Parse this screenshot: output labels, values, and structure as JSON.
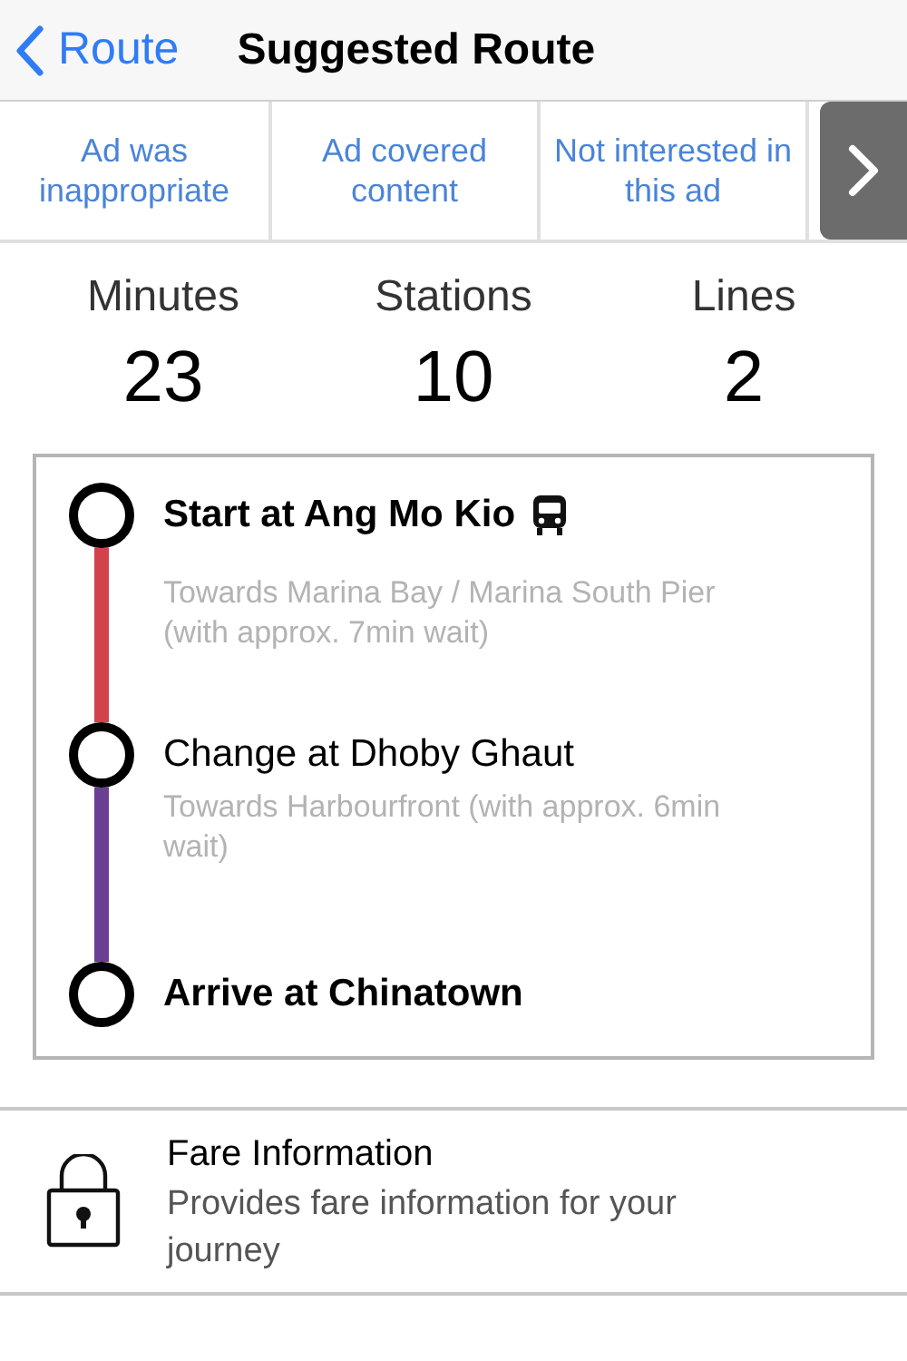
{
  "nav": {
    "back_label": "Route",
    "title": "Suggested Route"
  },
  "ad_feedback": {
    "options": [
      "Ad was inappropriate",
      "Ad covered content",
      "Not interested in this ad"
    ]
  },
  "stats": [
    {
      "label": "Minutes",
      "value": "23"
    },
    {
      "label": "Stations",
      "value": "10"
    },
    {
      "label": "Lines",
      "value": "2"
    }
  ],
  "route": {
    "stops": [
      {
        "name": "Start at Ang Mo Kio",
        "bold": true,
        "bus": true,
        "description": "Towards Marina Bay / Marina South Pier (with approx. 7min wait)",
        "color": "#d2424c"
      },
      {
        "name": "Change at Dhoby Ghaut",
        "bold": false,
        "bus": false,
        "description": "Towards Harbourfront (with approx. 6min wait)",
        "color": "#6a3e93"
      },
      {
        "name": "Arrive at Chinatown",
        "bold": true,
        "bus": false
      }
    ]
  },
  "fare": {
    "title": "Fare Information",
    "subtitle": "Provides fare information for your journey"
  }
}
